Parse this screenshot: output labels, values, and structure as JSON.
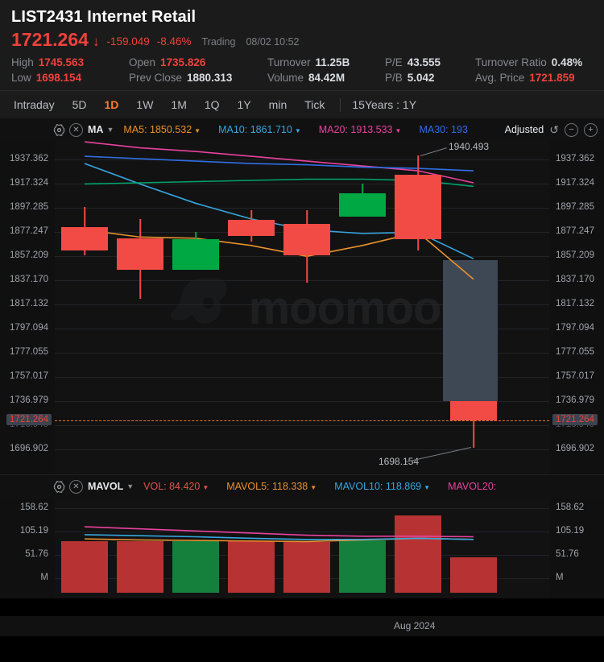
{
  "header": {
    "symbol": "LIST2431",
    "name": "Internet Retail",
    "price": "1721.264",
    "arrow": "↓",
    "change": "-159.049",
    "change_pct": "-8.46%",
    "market_status": "Trading",
    "timestamp": "08/02 10:52",
    "stats": [
      {
        "key": "High",
        "value": "1745.563",
        "red": true
      },
      {
        "key": "Open",
        "value": "1735.826",
        "red": true
      },
      {
        "key": "Turnover",
        "value": "11.25B",
        "red": false
      },
      {
        "key": "P/E",
        "value": "43.555",
        "red": false
      },
      {
        "key": "Turnover Ratio",
        "value": "0.48%",
        "red": false
      },
      {
        "key": "Low",
        "value": "1698.154",
        "red": true
      },
      {
        "key": "Prev Close",
        "value": "1880.313",
        "red": false
      },
      {
        "key": "Volume",
        "value": "84.42M",
        "red": false
      },
      {
        "key": "P/B",
        "value": "5.042",
        "red": false
      },
      {
        "key": "Avg. Price",
        "value": "1721.859",
        "red": true
      }
    ]
  },
  "period_tabs": {
    "items": [
      "Intraday",
      "5D",
      "1D",
      "1W",
      "1M",
      "1Q",
      "1Y",
      "min",
      "Tick"
    ],
    "active": "1D",
    "range_label": "15Years : 1Y"
  },
  "ma_indicator": {
    "name": "MA",
    "chevron": "⌄",
    "gear_icon": "gear-icon",
    "close_icon": "close-icon",
    "items": [
      {
        "label": "MA5: 1850.532",
        "color_class": "c-ma5"
      },
      {
        "label": "MA10: 1861.710",
        "color_class": "c-ma10"
      },
      {
        "label": "MA20: 1913.533",
        "color_class": "c-ma20"
      },
      {
        "label": "MA30: 193",
        "color_class": "c-ma30"
      }
    ],
    "adjusted_label": "Adjusted",
    "undo_icon": "↺",
    "zoom_out": "−",
    "zoom_in": "+"
  },
  "vol_indicator": {
    "name": "MAVOL",
    "chevron": "⌄",
    "items": [
      {
        "label": "VOL: 84.420",
        "color_class": "c-vol"
      },
      {
        "label": "MAVOL5: 118.338",
        "color_class": "c-mv5"
      },
      {
        "label": "MAVOL10: 118.869",
        "color_class": "c-mv10"
      },
      {
        "label": "MAVOL20:",
        "color_class": "c-mv20"
      }
    ]
  },
  "watermark": "moomoo",
  "annotations": {
    "high_label": "1940.493",
    "low_label": "1698.154"
  },
  "x_axis": {
    "label": "Aug 2024"
  },
  "chart_data": {
    "type": "candlestick",
    "title": "LIST2431 Internet Retail — 1D",
    "ylabel": "",
    "xlabel": "Aug 2024",
    "ylim": [
      1690.0,
      1947.0
    ],
    "grid": true,
    "price_axis_ticks": [
      "1937.362",
      "1917.324",
      "1897.285",
      "1877.247",
      "1857.209",
      "1837.170",
      "1817.132",
      "1797.094",
      "1777.055",
      "1757.017",
      "1736.979",
      "1716.940",
      "1696.902"
    ],
    "current_price": "1721.264",
    "annotation_high": 1940.493,
    "annotation_low": 1698.154,
    "candles": [
      {
        "i": 0,
        "open": 1881.0,
        "high": 1898.0,
        "low": 1858.0,
        "close": 1862.0,
        "dir": "down"
      },
      {
        "i": 1,
        "open": 1872.0,
        "high": 1888.0,
        "low": 1822.0,
        "close": 1846.0,
        "dir": "down"
      },
      {
        "i": 2,
        "open": 1846.0,
        "high": 1877.0,
        "low": 1846.0,
        "close": 1871.0,
        "dir": "up"
      },
      {
        "i": 3,
        "open": 1887.0,
        "high": 1895.0,
        "low": 1869.0,
        "close": 1874.0,
        "dir": "down"
      },
      {
        "i": 4,
        "open": 1884.0,
        "high": 1895.0,
        "low": 1835.0,
        "close": 1858.0,
        "dir": "down"
      },
      {
        "i": 5,
        "open": 1890.0,
        "high": 1917.0,
        "low": 1890.0,
        "close": 1909.0,
        "dir": "up"
      },
      {
        "i": 6,
        "open": 1925.0,
        "high": 1940.493,
        "low": 1862.0,
        "close": 1871.0,
        "dir": "down"
      },
      {
        "i": 7,
        "open": 1737.0,
        "high": 1737.0,
        "low": 1698.154,
        "close": 1721.264,
        "dir": "down"
      }
    ],
    "ma_series": [
      {
        "name": "MA5",
        "color": "#e8912d",
        "values": [
          1879,
          1873,
          1872,
          1866,
          1857,
          1866,
          1877,
          1838
        ]
      },
      {
        "name": "MA10",
        "color": "#36a7e0",
        "values": [
          1934,
          1917,
          1901,
          1888,
          1879,
          1876,
          1877,
          1855
        ]
      },
      {
        "name": "MA20",
        "color": "#e8439e",
        "values": [
          1952,
          1947,
          1944,
          1940,
          1936,
          1932,
          1928,
          1918
        ]
      },
      {
        "name": "MA30",
        "color": "#2f6fe4",
        "values": [
          1940,
          1938,
          1936,
          1934,
          1933,
          1931,
          1930,
          1928
        ]
      },
      {
        "name": "MA60",
        "color": "#00a36c",
        "values": [
          1917,
          1918,
          1919,
          1920,
          1921,
          1921,
          1920,
          1915
        ]
      }
    ],
    "gap_box": {
      "from_price": 1736.979,
      "to_price": 1854.0,
      "candle_index": 7
    },
    "volume": {
      "type": "bar",
      "ylabels": [
        "158.62",
        "105.19",
        "51.76",
        "M"
      ],
      "ylim": [
        0,
        180
      ],
      "values": [
        97,
        97,
        98,
        97,
        96,
        99,
        147,
        67
      ],
      "dirs": [
        "down",
        "down",
        "up",
        "down",
        "down",
        "up",
        "down",
        "down"
      ],
      "mavol_series": [
        {
          "name": "MAVOL5",
          "color": "#e8912d",
          "values": [
            102,
            100,
            99,
            98,
            97,
            100,
            103,
            101
          ]
        },
        {
          "name": "MAVOL10",
          "color": "#36a7e0",
          "values": [
            110,
            108,
            106,
            103,
            101,
            101,
            103,
            101
          ]
        },
        {
          "name": "MAVOL20",
          "color": "#e8439e",
          "values": [
            125,
            121,
            117,
            113,
            109,
            107,
            107,
            106
          ]
        }
      ]
    }
  }
}
